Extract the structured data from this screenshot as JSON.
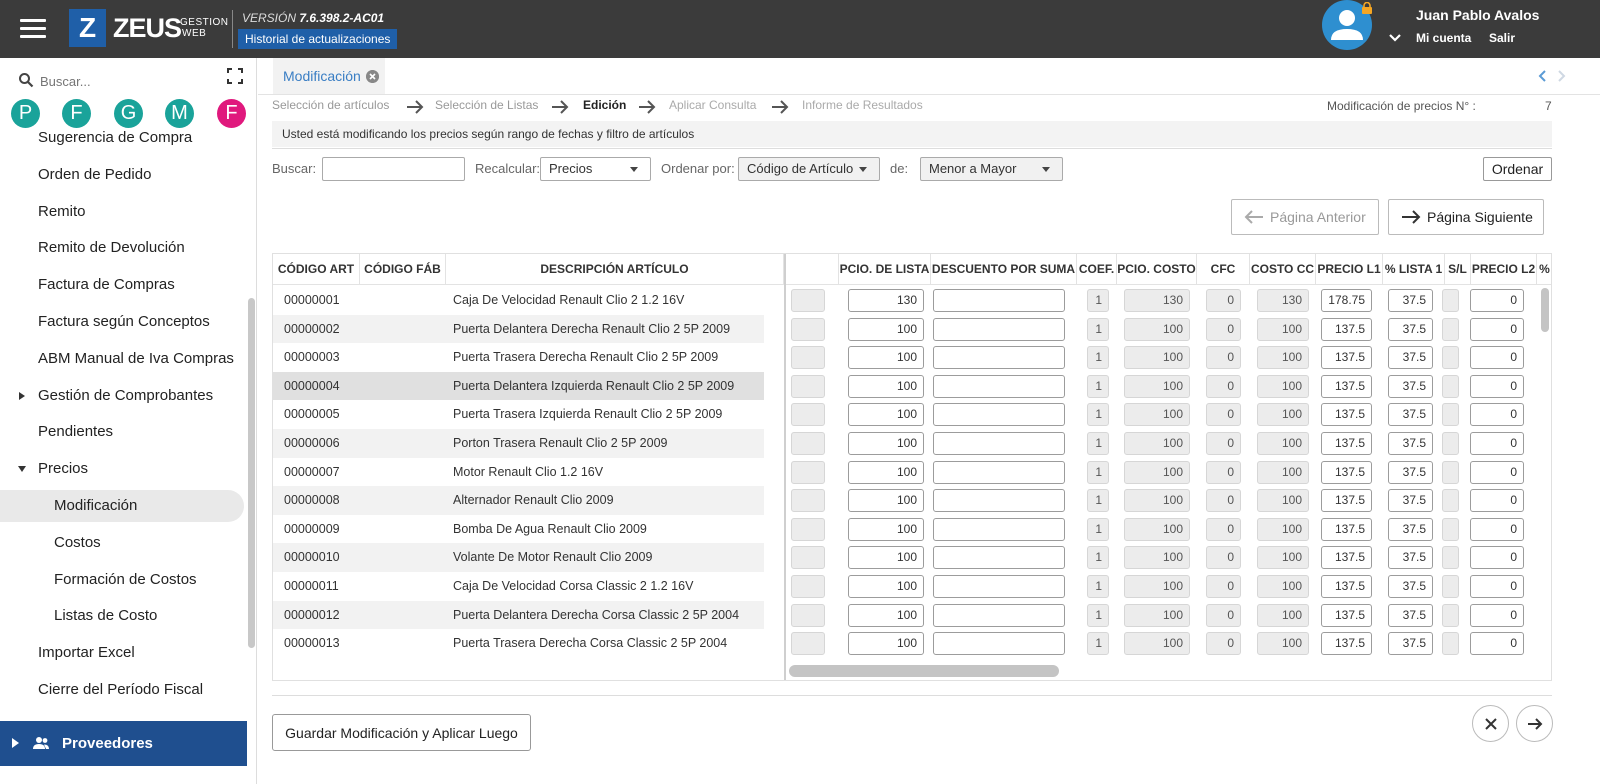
{
  "header": {
    "logo_letter": "Z",
    "logo_text": "ZEUS",
    "logo_sub_line1": "GESTION",
    "logo_sub_line2": "WEB",
    "version_prefix": "VERSIÓN",
    "version_number": "7.6.398.2-AC01",
    "updates_label": "Historial de actualizaciones",
    "user_name": "Juan Pablo Avalos",
    "my_account": "Mi cuenta",
    "logout": "Salir",
    "accent_color": "#1f5fa8"
  },
  "sidebar": {
    "search_placeholder": "Buscar...",
    "favorites": [
      {
        "letter": "P",
        "color": "#1aa39a"
      },
      {
        "letter": "F",
        "color": "#1aa39a"
      },
      {
        "letter": "G",
        "color": "#1aa39a"
      },
      {
        "letter": "M",
        "color": "#1aa39a"
      },
      {
        "letter": "F",
        "color": "#e0197d"
      }
    ],
    "items": [
      {
        "label": "Sugerencia de Compra",
        "level": 1
      },
      {
        "label": "Orden de Pedido",
        "level": 1
      },
      {
        "label": "Remito",
        "level": 1
      },
      {
        "label": "Remito de Devolución",
        "level": 1
      },
      {
        "label": "Factura de Compras",
        "level": 1
      },
      {
        "label": "Factura según Conceptos",
        "level": 1
      },
      {
        "label": "ABM Manual de Iva Compras",
        "level": 1
      },
      {
        "label": "Gestión de Comprobantes",
        "level": 1,
        "arrow": "right"
      },
      {
        "label": "Pendientes",
        "level": 1
      },
      {
        "label": "Precios",
        "level": 1,
        "arrow": "down"
      },
      {
        "label": "Modificación",
        "level": 2,
        "active": true
      },
      {
        "label": "Costos",
        "level": 2
      },
      {
        "label": "Formación de Costos",
        "level": 2
      },
      {
        "label": "Listas de Costo",
        "level": 2
      },
      {
        "label": "Importar Excel",
        "level": 1
      },
      {
        "label": "Cierre del Período Fiscal",
        "level": 1
      }
    ],
    "section_footer": "Proveedores"
  },
  "tab": {
    "label": "Modificación"
  },
  "wizard": {
    "steps": [
      {
        "label": "Selección de artículos",
        "state": "done"
      },
      {
        "label": "Selección de Listas",
        "state": "done"
      },
      {
        "label": "Edición",
        "state": "current"
      },
      {
        "label": "Aplicar Consulta",
        "state": "pending"
      },
      {
        "label": "Informe de Resultados",
        "state": "pending"
      }
    ],
    "mod_number_label": "Modificación de precios N° :",
    "mod_number": "7",
    "info": "Usted está modificando los precios según rango de fechas y filtro de artículos"
  },
  "filters": {
    "search_label": "Buscar:",
    "search_value": "",
    "recalc_label": "Recalcular:",
    "recalc_value": "Precios",
    "order_by_label": "Ordenar por:",
    "order_by_value": "Código de Artículo",
    "direction_label": "de:",
    "direction_value": "Menor a Mayor",
    "order_button": "Ordenar",
    "prev_page": "Página Anterior",
    "next_page": "Página Siguiente"
  },
  "grid": {
    "columns": [
      "CÓDIGO ART",
      "CÓDIGO FÁB",
      "DESCRIPCIÓN ARTÍCULO",
      "",
      "PCIO. DE LISTA",
      "DESCUENTO POR SUMA",
      "COEF.",
      "PCIO. COSTO",
      "CFC",
      "COSTO CC",
      "PRECIO L1",
      "% LISTA 1",
      "S/L",
      "PRECIO L2",
      "%"
    ],
    "rows": [
      {
        "code": "00000001",
        "fab": "",
        "desc": "Caja De Velocidad Renault Clio 2 1.2 16V",
        "pcio_lista": "130",
        "descuento": "",
        "coef": "1",
        "pcio_costo": "130",
        "cfc": "0",
        "costo_cc": "130",
        "precio_l1": "178.75",
        "pct_l1": "37.5",
        "precio_l2": "0"
      },
      {
        "code": "00000002",
        "fab": "",
        "desc": "Puerta Delantera Derecha Renault Clio 2 5P 2009",
        "pcio_lista": "100",
        "descuento": "",
        "coef": "1",
        "pcio_costo": "100",
        "cfc": "0",
        "costo_cc": "100",
        "precio_l1": "137.5",
        "pct_l1": "37.5",
        "precio_l2": "0"
      },
      {
        "code": "00000003",
        "fab": "",
        "desc": "Puerta Trasera Derecha Renault Clio 2 5P 2009",
        "pcio_lista": "100",
        "descuento": "",
        "coef": "1",
        "pcio_costo": "100",
        "cfc": "0",
        "costo_cc": "100",
        "precio_l1": "137.5",
        "pct_l1": "37.5",
        "precio_l2": "0"
      },
      {
        "code": "00000004",
        "fab": "",
        "desc": "Puerta Delantera Izquierda Renault Clio 2 5P 2009",
        "pcio_lista": "100",
        "descuento": "",
        "coef": "1",
        "pcio_costo": "100",
        "cfc": "0",
        "costo_cc": "100",
        "precio_l1": "137.5",
        "pct_l1": "37.5",
        "precio_l2": "0"
      },
      {
        "code": "00000005",
        "fab": "",
        "desc": "Puerta Trasera Izquierda Renault Clio 2 5P 2009",
        "pcio_lista": "100",
        "descuento": "",
        "coef": "1",
        "pcio_costo": "100",
        "cfc": "0",
        "costo_cc": "100",
        "precio_l1": "137.5",
        "pct_l1": "37.5",
        "precio_l2": "0"
      },
      {
        "code": "00000006",
        "fab": "",
        "desc": "Porton Trasera Renault Clio 2 5P 2009",
        "pcio_lista": "100",
        "descuento": "",
        "coef": "1",
        "pcio_costo": "100",
        "cfc": "0",
        "costo_cc": "100",
        "precio_l1": "137.5",
        "pct_l1": "37.5",
        "precio_l2": "0"
      },
      {
        "code": "00000007",
        "fab": "",
        "desc": "Motor Renault Clio 1.2 16V",
        "pcio_lista": "100",
        "descuento": "",
        "coef": "1",
        "pcio_costo": "100",
        "cfc": "0",
        "costo_cc": "100",
        "precio_l1": "137.5",
        "pct_l1": "37.5",
        "precio_l2": "0"
      },
      {
        "code": "00000008",
        "fab": "",
        "desc": "Alternador Renault Clio 2009",
        "pcio_lista": "100",
        "descuento": "",
        "coef": "1",
        "pcio_costo": "100",
        "cfc": "0",
        "costo_cc": "100",
        "precio_l1": "137.5",
        "pct_l1": "37.5",
        "precio_l2": "0"
      },
      {
        "code": "00000009",
        "fab": "",
        "desc": "Bomba De Agua Renault Clio 2009",
        "pcio_lista": "100",
        "descuento": "",
        "coef": "1",
        "pcio_costo": "100",
        "cfc": "0",
        "costo_cc": "100",
        "precio_l1": "137.5",
        "pct_l1": "37.5",
        "precio_l2": "0"
      },
      {
        "code": "00000010",
        "fab": "",
        "desc": "Volante De Motor Renault Clio 2009",
        "pcio_lista": "100",
        "descuento": "",
        "coef": "1",
        "pcio_costo": "100",
        "cfc": "0",
        "costo_cc": "100",
        "precio_l1": "137.5",
        "pct_l1": "37.5",
        "precio_l2": "0"
      },
      {
        "code": "00000011",
        "fab": "",
        "desc": "Caja De Velocidad Corsa Classic 2 1.2 16V",
        "pcio_lista": "100",
        "descuento": "",
        "coef": "1",
        "pcio_costo": "100",
        "cfc": "0",
        "costo_cc": "100",
        "precio_l1": "137.5",
        "pct_l1": "37.5",
        "precio_l2": "0"
      },
      {
        "code": "00000012",
        "fab": "",
        "desc": "Puerta Delantera Derecha Corsa Classic 2 5P 2004",
        "pcio_lista": "100",
        "descuento": "",
        "coef": "1",
        "pcio_costo": "100",
        "cfc": "0",
        "costo_cc": "100",
        "precio_l1": "137.5",
        "pct_l1": "37.5",
        "precio_l2": "0"
      },
      {
        "code": "00000013",
        "fab": "",
        "desc": "Puerta Trasera Derecha Corsa Classic 2 5P 2004",
        "pcio_lista": "100",
        "descuento": "",
        "coef": "1",
        "pcio_costo": "100",
        "cfc": "0",
        "costo_cc": "100",
        "precio_l1": "137.5",
        "pct_l1": "37.5",
        "precio_l2": "0"
      }
    ],
    "highlighted_row": 3
  },
  "footer": {
    "save_button": "Guardar Modificación y Aplicar Luego"
  }
}
